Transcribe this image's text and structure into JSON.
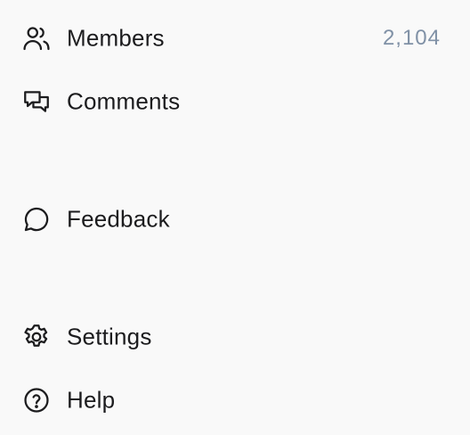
{
  "nav": {
    "members": {
      "label": "Members",
      "count": "2,104",
      "icon": "users-icon"
    },
    "comments": {
      "label": "Comments",
      "icon": "comments-icon"
    },
    "feedback": {
      "label": "Feedback",
      "icon": "chat-bubble-icon"
    },
    "settings": {
      "label": "Settings",
      "icon": "gear-icon"
    },
    "help": {
      "label": "Help",
      "icon": "help-circle-icon"
    }
  },
  "colors": {
    "background": "#f9f9f9",
    "text": "#1c1c1e",
    "count": "#8091a6"
  }
}
